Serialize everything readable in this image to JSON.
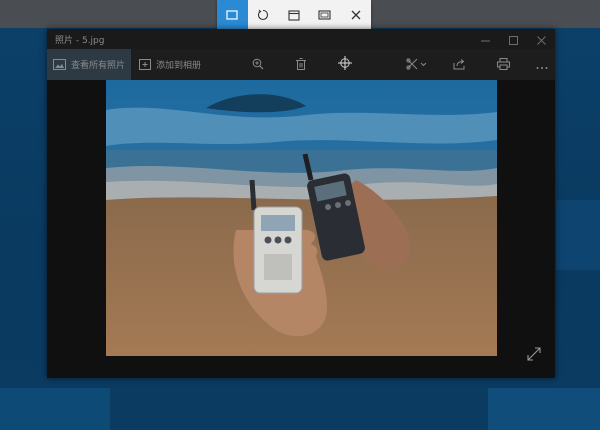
{
  "snip_toolbar": {
    "buttons": [
      {
        "icon": "rectangular-snip-icon"
      },
      {
        "icon": "freeform-snip-icon"
      },
      {
        "icon": "window-snip-icon"
      },
      {
        "icon": "fullscreen-snip-icon"
      },
      {
        "icon": "close-icon"
      }
    ]
  },
  "window": {
    "title": "照片 - 5.jpg",
    "controls": [
      "minimize-icon",
      "maximize-icon",
      "close-icon"
    ]
  },
  "toolbar": {
    "view_all_photos": "查看所有照片",
    "add_to_album": "添加到相册",
    "icons": [
      "zoom-icon",
      "delete-icon",
      "enhance-icon",
      "edit-icon",
      "share-icon",
      "print-icon",
      "more-icon"
    ]
  },
  "viewer": {
    "expand_icon": "expand-icon"
  },
  "colors": {
    "accent": "#2a8ad4",
    "desktop": "#0c416a",
    "window_bg": "#151515"
  }
}
